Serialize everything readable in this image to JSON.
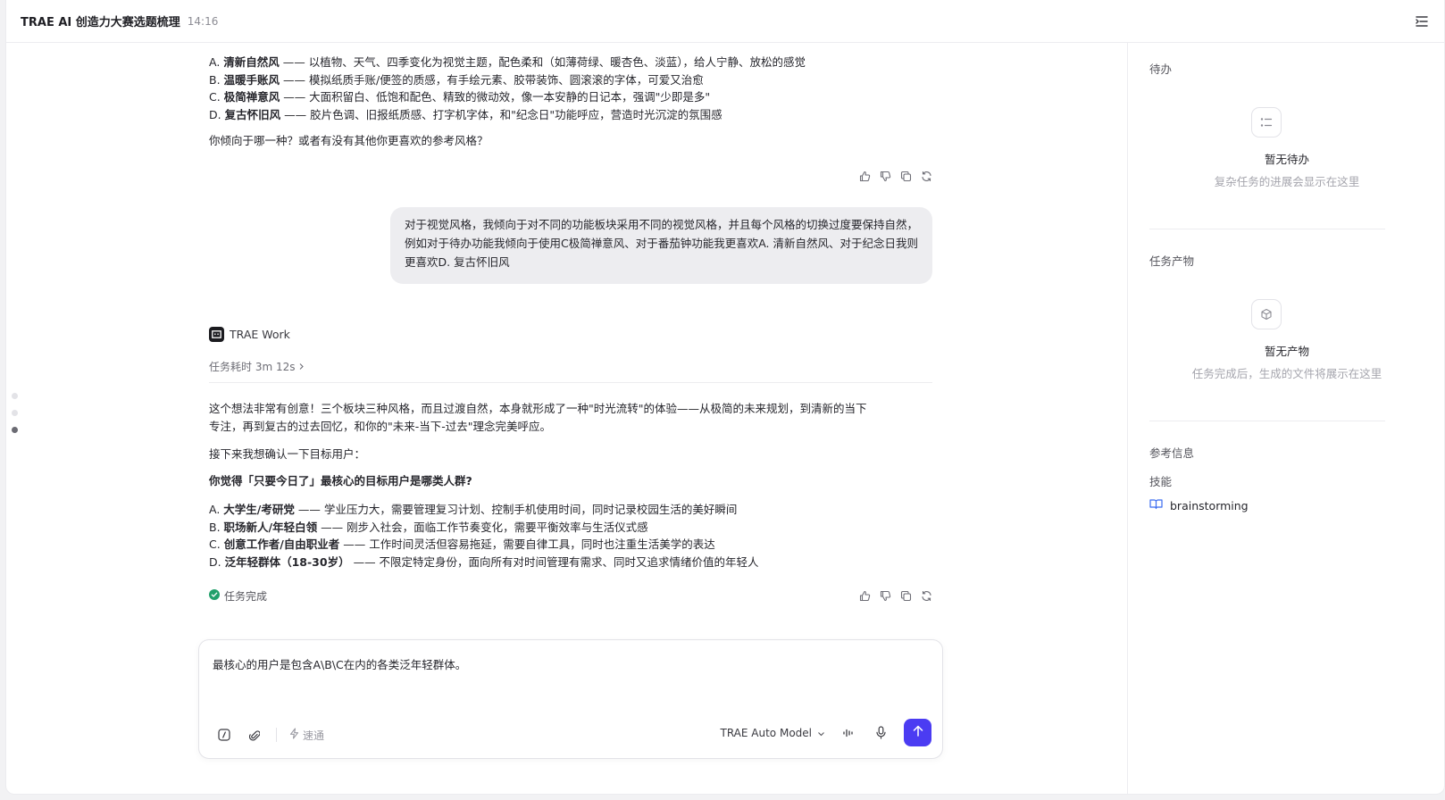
{
  "header": {
    "title": "TRAE AI 创造力大赛选题梳理",
    "time": "14:16",
    "menu_icon": "sidebar-toggle-icon"
  },
  "chat": {
    "style_options": [
      {
        "letter": "A.",
        "name": "清新自然风",
        "desc": "—— 以植物、天气、四季变化为视觉主题，配色柔和（如薄荷绿、暖杏色、淡蓝），给人宁静、放松的感觉"
      },
      {
        "letter": "B.",
        "name": "温暖手账风",
        "desc": "—— 模拟纸质手账/便签的质感，有手绘元素、胶带装饰、圆滚滚的字体，可爱又治愈"
      },
      {
        "letter": "C.",
        "name": "极简禅意风",
        "desc": "—— 大面积留白、低饱和配色、精致的微动效，像一本安静的日记本，强调\"少即是多\""
      },
      {
        "letter": "D.",
        "name": "复古怀旧风",
        "desc": "—— 胶片色调、旧报纸质感、打字机字体，和\"纪念日\"功能呼应，营造时光沉淀的氛围感"
      }
    ],
    "style_question": "你倾向于哪一种？或者有没有其他你更喜欢的参考风格？",
    "user_message": "对于视觉风格，我倾向于对不同的功能板块采用不同的视觉风格，并且每个风格的切换过度要保持自然，例如对于待办功能我倾向于使用C极简禅意风、对于番茄钟功能我更喜欢A. 清新自然风、对于纪念日我则更喜欢D. 复古怀旧风",
    "agent_name": "TRAE Work",
    "task_time": "任务耗时 3m 12s",
    "reply_para1_line1": "这个想法非常有创意！三个板块三种风格，而且过渡自然，本身就形成了一种\"时光流转\"的体验——从极简的未来规划，到清新的当下",
    "reply_para1_line2": "专注，再到复古的过去回忆，和你的\"未来-当下-过去\"理念完美呼应。",
    "reply_para2": "接下来我想确认一下目标用户：",
    "reply_question": "你觉得「只要今日了」最核心的目标用户是哪类人群?",
    "user_options": [
      {
        "letter": "A.",
        "name": "大学生/考研党",
        "desc": "—— 学业压力大，需要管理复习计划、控制手机使用时间，同时记录校园生活的美好瞬间"
      },
      {
        "letter": "B.",
        "name": "职场新人/年轻白领",
        "desc": "—— 刚步入社会，面临工作节奏变化，需要平衡效率与生活仪式感"
      },
      {
        "letter": "C.",
        "name": "创意工作者/自由职业者",
        "desc": "—— 工作时间灵活但容易拖延，需要自律工具，同时也注重生活美学的表达"
      },
      {
        "letter": "D.",
        "name": "泛年轻群体（18-30岁）",
        "desc": "—— 不限定特定身份，面向所有对时间管理有需求、同时又追求情绪价值的年轻人"
      }
    ],
    "done_label": "任务完成"
  },
  "composer": {
    "input_value": "最核心的用户是包含A\\B\\C在内的各类泛年轻群体。",
    "speed_label": "速通",
    "model_label": "TRAE Auto Model"
  },
  "side": {
    "todo_title": "待办",
    "todo_empty_title": "暂无待办",
    "todo_empty_desc": "复杂任务的进展会显示在这里",
    "artifact_title": "任务产物",
    "artifact_empty_title": "暂无产物",
    "artifact_empty_desc": "任务完成后，生成的文件将展示在这里",
    "ref_title": "参考信息",
    "skill_title": "技能",
    "skill_name": "brainstorming"
  },
  "colors": {
    "accent": "#4b3cf2",
    "success": "#22a06b",
    "skill_icon": "#3b6cf0"
  }
}
